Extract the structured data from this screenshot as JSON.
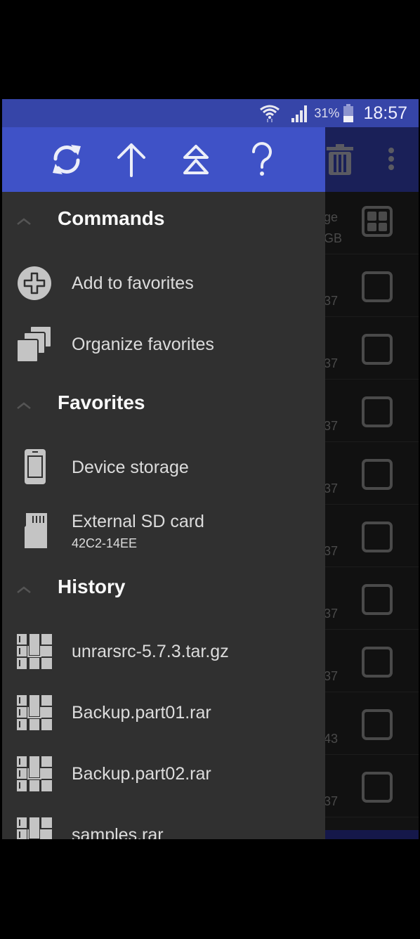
{
  "status_bar": {
    "battery_percent": "31%",
    "time": "18:57",
    "icons": [
      "wifi-icon",
      "signal-icon",
      "battery-icon"
    ]
  },
  "drawer": {
    "toolbar": [
      {
        "name": "refresh-button",
        "icon": "refresh-icon"
      },
      {
        "name": "up-button",
        "icon": "arrow-up-icon"
      },
      {
        "name": "root-button",
        "icon": "double-up-triangle-icon"
      },
      {
        "name": "help-button",
        "icon": "help-icon"
      }
    ],
    "sections": {
      "commands": {
        "title": "Commands",
        "items": [
          {
            "label": "Add to favorites",
            "icon": "add-circle-icon"
          },
          {
            "label": "Organize favorites",
            "icon": "stacked-squares-icon"
          }
        ]
      },
      "favorites": {
        "title": "Favorites",
        "items": [
          {
            "label": "Device storage",
            "icon": "phone-icon"
          },
          {
            "label": "External SD card",
            "sub": "42C2-14EE",
            "icon": "sd-card-icon"
          }
        ]
      },
      "history": {
        "title": "History",
        "items": [
          {
            "label": "unrarsrc-5.7.3.tar.gz",
            "icon": "archive-icon"
          },
          {
            "label": "Backup.part01.rar",
            "icon": "archive-icon"
          },
          {
            "label": "Backup.part02.rar",
            "icon": "archive-icon"
          },
          {
            "label": "samples.rar",
            "icon": "archive-icon"
          }
        ]
      }
    }
  },
  "background_app": {
    "toolbar_icons": [
      "trash-icon",
      "more-vert-icon"
    ],
    "rows": [
      {
        "meta1": "ge",
        "meta2": "GB",
        "control": "select-all"
      },
      {
        "meta1": "",
        "meta2": "37",
        "control": "checkbox"
      },
      {
        "meta1": "",
        "meta2": "37",
        "control": "checkbox"
      },
      {
        "meta1": "",
        "meta2": "37",
        "control": "checkbox"
      },
      {
        "meta1": "",
        "meta2": "37",
        "control": "checkbox"
      },
      {
        "meta1": "",
        "meta2": "37",
        "control": "checkbox"
      },
      {
        "meta1": "",
        "meta2": "37",
        "control": "checkbox"
      },
      {
        "meta1": "",
        "meta2": "37",
        "control": "checkbox"
      },
      {
        "meta1": "",
        "meta2": "43",
        "control": "checkbox"
      },
      {
        "meta1": "",
        "meta2": "37",
        "control": "checkbox"
      }
    ]
  },
  "colors": {
    "status_bar": "#3645a8",
    "drawer_toolbar": "#3f52c7",
    "drawer_bg": "#303030",
    "icon_gray": "#c4c4c4"
  }
}
